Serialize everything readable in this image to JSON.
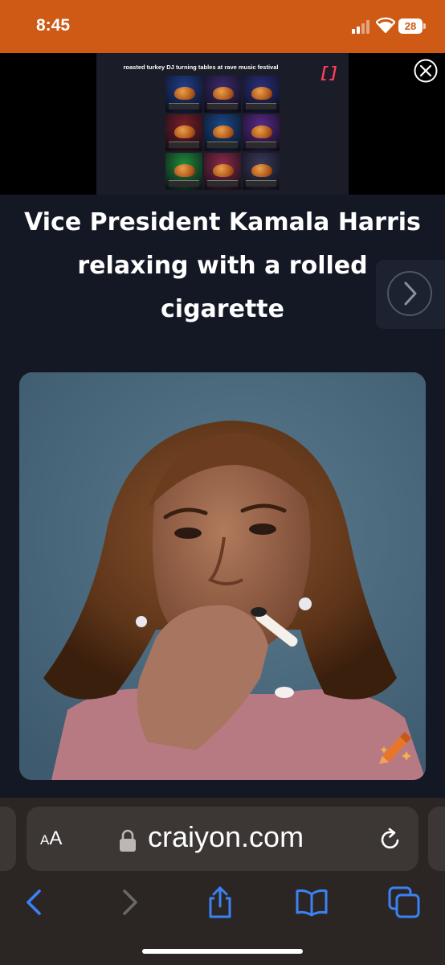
{
  "status_bar": {
    "time": "8:45",
    "battery": "28",
    "background_color": "#ce5a15"
  },
  "ad": {
    "caption": "roasted turkey DJ turning tables at rave music festival",
    "logo": "[]",
    "tile_backgrounds": [
      "#1f3f8a",
      "#3a2a6a",
      "#2a2f7a",
      "#7a1f2a",
      "#1a4a8a",
      "#5a2a8a",
      "#1f8a3a",
      "#8a2a4a",
      "#3a3a5a"
    ],
    "close_icon": "close-circle-icon"
  },
  "page": {
    "title": "Vice President Kamala Harris relaxing with a rolled cigarette",
    "next_icon": "chevron-right-icon"
  },
  "image": {
    "badge_icon": "crayon-icon",
    "accent_color": "#e7762b"
  },
  "browser": {
    "reader_label_large": "A",
    "reader_label_small": "A",
    "url": "craiyon.com",
    "lock_icon": "lock-icon",
    "reload_icon": "reload-icon",
    "toolbar_icons": [
      "back-icon",
      "forward-icon",
      "share-icon",
      "bookmarks-icon",
      "tabs-icon"
    ],
    "accent_color": "#3b82f6"
  }
}
